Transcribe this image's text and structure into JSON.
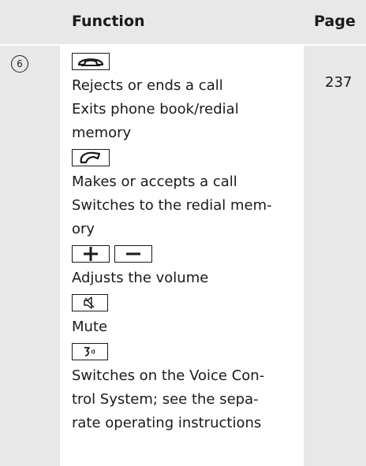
{
  "header": {
    "function_label": "Function",
    "page_label": "Page"
  },
  "row": {
    "number": "6",
    "page": "237",
    "lines": {
      "end_call_1": "Rejects or ends a call",
      "end_call_2a": "Exits phone book/redial",
      "end_call_2b": "memory",
      "accept_1": "Makes or accepts a call",
      "accept_2a": "Switches to the redial mem-",
      "accept_2b": "ory",
      "volume": "Adjusts the volume",
      "mute": "Mute",
      "voice_a": "Switches on the Voice Con-",
      "voice_b": "trol System; see the sepa-",
      "voice_c": "rate operating instructions"
    },
    "keys": {
      "end": "phone-hang-up-icon",
      "accept": "phone-pick-up-icon",
      "plus": "plus-icon",
      "minus": "minus-icon",
      "mute": "mute-speaker-icon",
      "voice": "voice-control-icon"
    }
  }
}
